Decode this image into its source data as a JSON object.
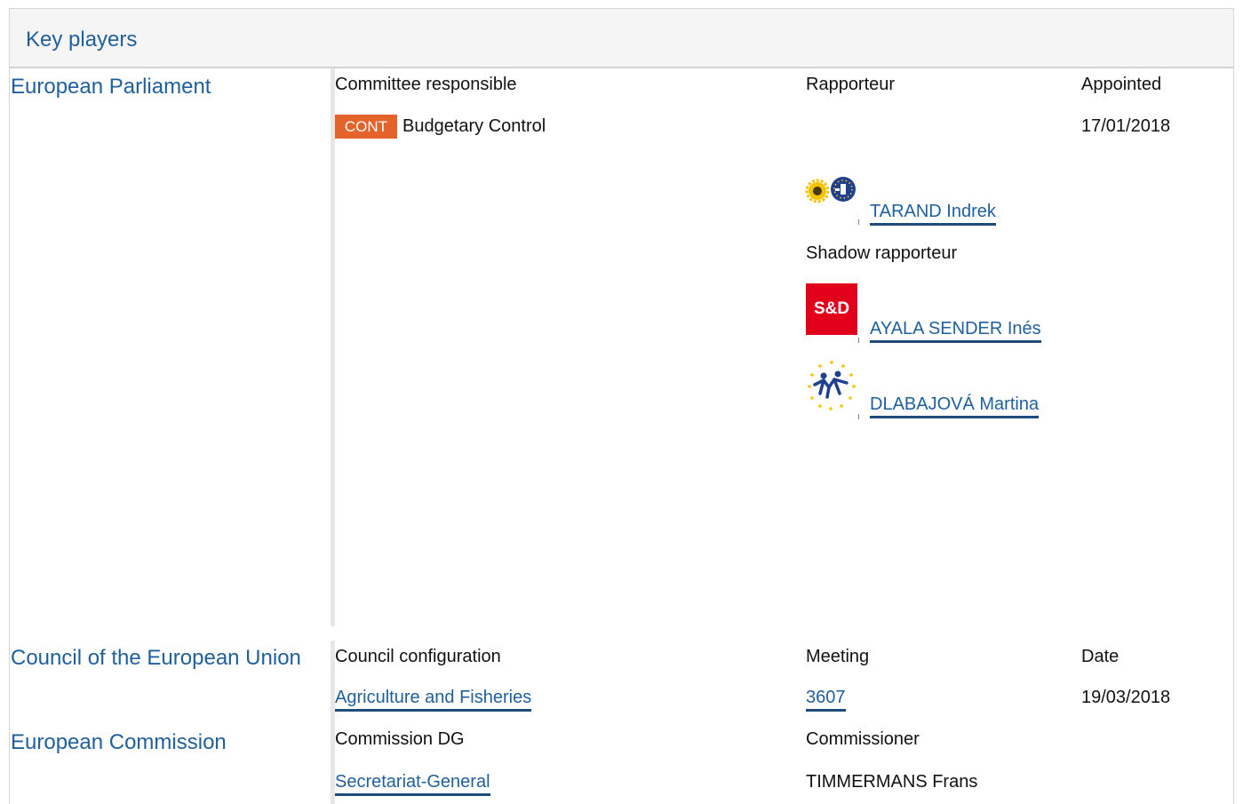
{
  "panel": {
    "title": "Key players"
  },
  "parliament": {
    "name": "European Parliament",
    "committee_header": "Committee responsible",
    "rapporteur_header": "Rapporteur",
    "appointed_header": "Appointed",
    "committee_code": "CONT",
    "committee_name": "Budgetary Control",
    "appointed_date": "17/01/2018",
    "rapporteur": {
      "name": "TARAND Indrek",
      "group_icon": "greens-efa-logo-icon"
    },
    "shadow_header": "Shadow rapporteur",
    "shadows": [
      {
        "name": "AYALA SENDER Inés",
        "group_icon": "s-and-d-logo-icon",
        "logo_text": "S&D"
      },
      {
        "name": "DLABAJOVÁ Martina",
        "group_icon": "alde-logo-icon"
      }
    ]
  },
  "council": {
    "name": "Council of the European Union",
    "configuration_header": "Council configuration",
    "meeting_header": "Meeting",
    "date_header": "Date",
    "configuration": "Agriculture and Fisheries",
    "meeting": "3607",
    "date": "19/03/2018"
  },
  "commission": {
    "name": "European Commission",
    "dg_header": "Commission DG",
    "commissioner_header": "Commissioner",
    "dg": "Secretariat-General",
    "commissioner": "TIMMERMANS Frans"
  },
  "colors": {
    "link": "#1f5f9e",
    "badge": "#e4632b",
    "sd_red": "#e3001b"
  }
}
